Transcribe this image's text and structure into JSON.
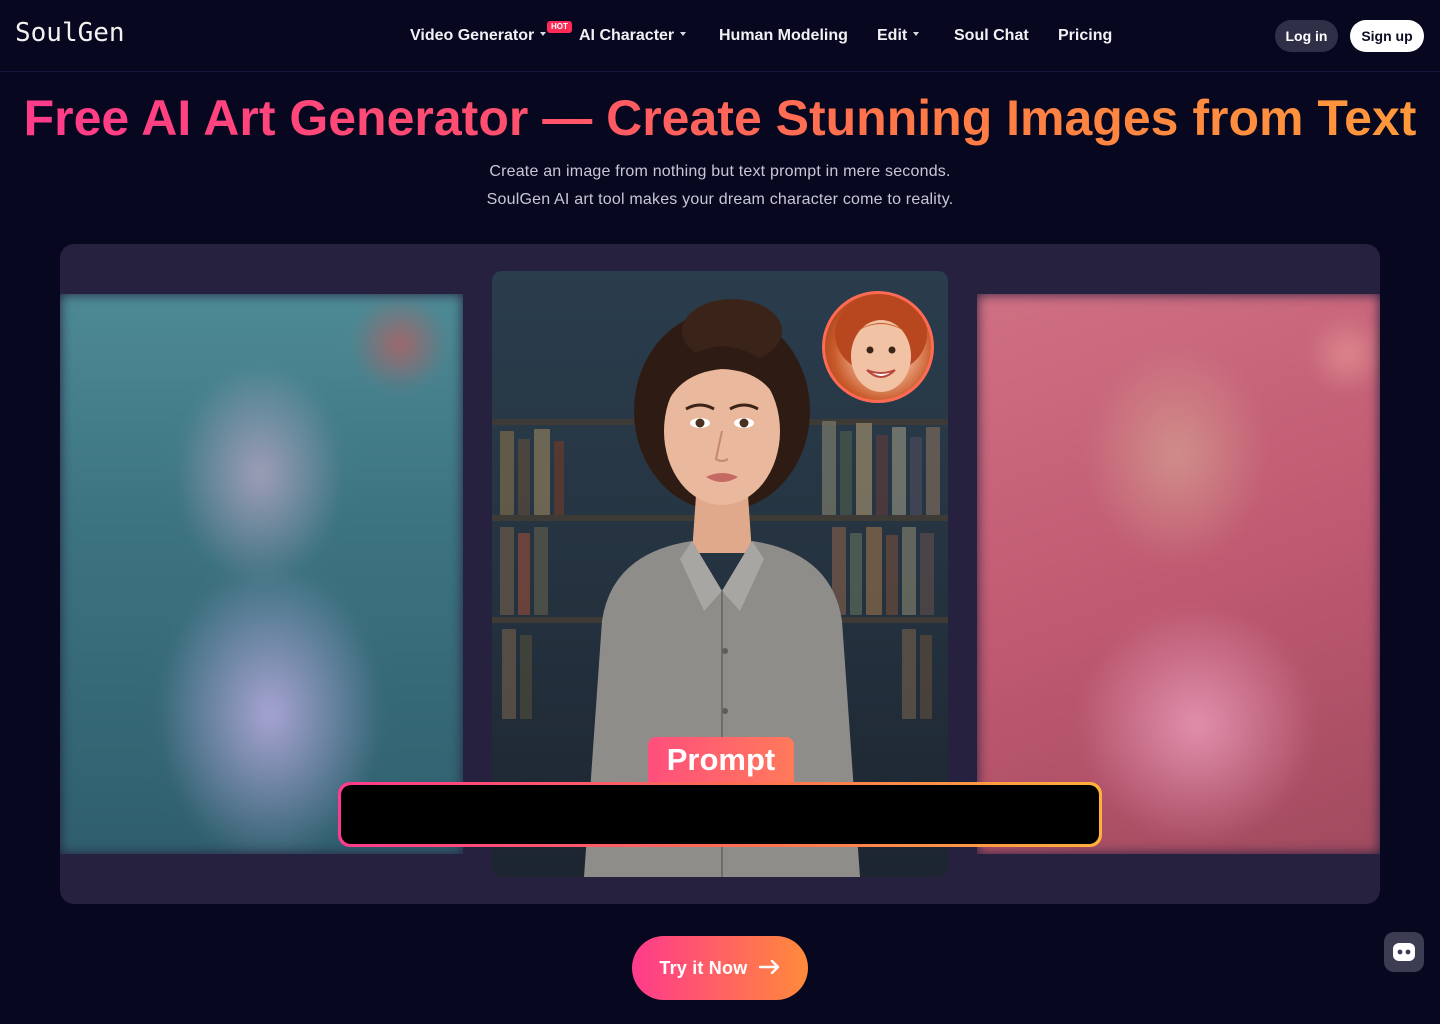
{
  "brand": {
    "logo": "SoulGen"
  },
  "nav": {
    "items": [
      {
        "label": "Video Generator",
        "dropdown": true,
        "badge": "HOT"
      },
      {
        "label": "AI Character",
        "dropdown": true
      },
      {
        "label": "Human Modeling",
        "dropdown": false
      },
      {
        "label": "Edit",
        "dropdown": true
      },
      {
        "label": "Soul Chat",
        "dropdown": false
      },
      {
        "label": "Pricing",
        "dropdown": false
      }
    ]
  },
  "auth": {
    "login_label": "Log in",
    "signup_label": "Sign up"
  },
  "hero": {
    "title": "Free AI Art Generator — Create Stunning Images from Text",
    "subtitle_line1": "Create an image from nothing but text prompt in mere seconds.",
    "subtitle_line2": "SoulGen AI art tool makes your dream character come to reality."
  },
  "showcase": {
    "prompt_label": "Prompt",
    "prompt_value": ""
  },
  "cta": {
    "label": "Try it Now",
    "icon": "arrow-right-icon"
  },
  "chat_widget": {
    "icon": "chat-bubble-icon"
  },
  "colors": {
    "background": "#07071f",
    "accent_start": "#ff3a8c",
    "accent_end": "#ff8a3a",
    "hot_badge": "#ff2a55",
    "panel": "#26213f"
  }
}
